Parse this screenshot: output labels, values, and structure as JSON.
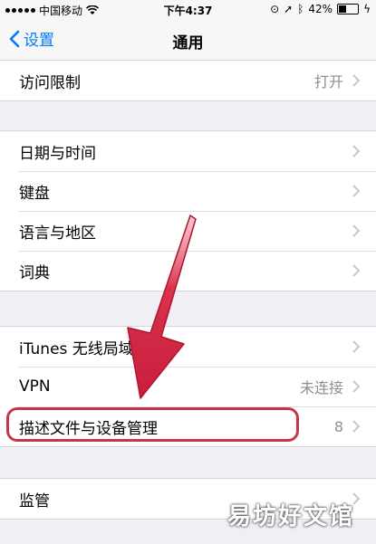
{
  "status_bar": {
    "carrier": "中国移动",
    "time": "下午4:37",
    "battery": "42%",
    "battery_level": 0.42
  },
  "nav": {
    "back_label": "设置",
    "title": "通用"
  },
  "rows": {
    "restrictions": {
      "label": "访问限制",
      "value": "打开"
    },
    "datetime": {
      "label": "日期与时间"
    },
    "keyboard": {
      "label": "键盘"
    },
    "language": {
      "label": "语言与地区"
    },
    "dictionary": {
      "label": "词典"
    },
    "itunes_sync": {
      "label": "iTunes 无线局域网同步"
    },
    "vpn": {
      "label": "VPN",
      "value": "未连接"
    },
    "profiles": {
      "label": "描述文件与设备管理",
      "value": "8"
    },
    "supervision": {
      "label": "监管"
    }
  },
  "watermark": "易坊好文馆",
  "colors": {
    "accent": "#007aff",
    "annotation": "#c7354a",
    "background": "#efeff4"
  }
}
